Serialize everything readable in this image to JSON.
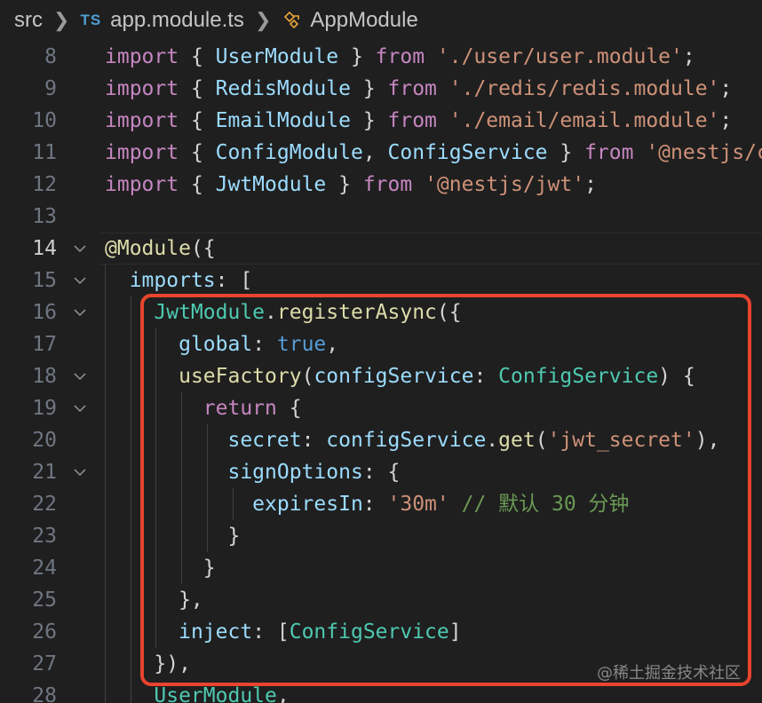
{
  "breadcrumb": {
    "folder": "src",
    "file_lang": "TS",
    "file": "app.module.ts",
    "symbol": "AppModule"
  },
  "colors": {
    "keyword": "#c586c0",
    "variable": "#9cdcfe",
    "string": "#ce9178",
    "type": "#4ec9b0",
    "function": "#dcdcaa",
    "comment": "#6a9955",
    "highlight_box": "#e8442e"
  },
  "lines": [
    {
      "num": "8",
      "fold": false,
      "tokens": [
        [
          "kw",
          "import"
        ],
        [
          "punc",
          " { "
        ],
        [
          "var",
          "UserModule"
        ],
        [
          "punc",
          " } "
        ],
        [
          "kw",
          "from"
        ],
        [
          "punc",
          " "
        ],
        [
          "str",
          "'./user/user.module'"
        ],
        [
          "punc",
          ";"
        ]
      ]
    },
    {
      "num": "9",
      "fold": false,
      "tokens": [
        [
          "kw",
          "import"
        ],
        [
          "punc",
          " { "
        ],
        [
          "var",
          "RedisModule"
        ],
        [
          "punc",
          " } "
        ],
        [
          "kw",
          "from"
        ],
        [
          "punc",
          " "
        ],
        [
          "str",
          "'./redis/redis.module'"
        ],
        [
          "punc",
          ";"
        ]
      ]
    },
    {
      "num": "10",
      "fold": false,
      "tokens": [
        [
          "kw",
          "import"
        ],
        [
          "punc",
          " { "
        ],
        [
          "var",
          "EmailModule"
        ],
        [
          "punc",
          " } "
        ],
        [
          "kw",
          "from"
        ],
        [
          "punc",
          " "
        ],
        [
          "str",
          "'./email/email.module'"
        ],
        [
          "punc",
          ";"
        ]
      ]
    },
    {
      "num": "11",
      "fold": false,
      "tokens": [
        [
          "kw",
          "import"
        ],
        [
          "punc",
          " { "
        ],
        [
          "var",
          "ConfigModule"
        ],
        [
          "punc",
          ", "
        ],
        [
          "var",
          "ConfigService"
        ],
        [
          "punc",
          " } "
        ],
        [
          "kw",
          "from"
        ],
        [
          "punc",
          " "
        ],
        [
          "str",
          "'@nestjs/config'"
        ],
        [
          "punc",
          ";"
        ]
      ]
    },
    {
      "num": "12",
      "fold": false,
      "tokens": [
        [
          "kw",
          "import"
        ],
        [
          "punc",
          " { "
        ],
        [
          "var",
          "JwtModule"
        ],
        [
          "punc",
          " } "
        ],
        [
          "kw",
          "from"
        ],
        [
          "punc",
          " "
        ],
        [
          "str",
          "'@nestjs/jwt'"
        ],
        [
          "punc",
          ";"
        ]
      ]
    },
    {
      "num": "13",
      "fold": false,
      "tokens": []
    },
    {
      "num": "14",
      "fold": true,
      "current": true,
      "tokens": [
        [
          "fn",
          "@Module"
        ],
        [
          "punc",
          "("
        ],
        [
          "punc",
          "{"
        ]
      ]
    },
    {
      "num": "15",
      "fold": true,
      "tokens": [
        [
          "punc",
          "  "
        ],
        [
          "var",
          "imports"
        ],
        [
          "punc",
          ": ["
        ]
      ]
    },
    {
      "num": "16",
      "fold": true,
      "tokens": [
        [
          "punc",
          "    "
        ],
        [
          "type",
          "JwtModule"
        ],
        [
          "punc",
          "."
        ],
        [
          "fn",
          "registerAsync"
        ],
        [
          "punc",
          "({"
        ]
      ]
    },
    {
      "num": "17",
      "fold": false,
      "tokens": [
        [
          "punc",
          "      "
        ],
        [
          "var",
          "global"
        ],
        [
          "punc",
          ": "
        ],
        [
          "bool",
          "true"
        ],
        [
          "punc",
          ","
        ]
      ]
    },
    {
      "num": "18",
      "fold": true,
      "tokens": [
        [
          "punc",
          "      "
        ],
        [
          "fn",
          "useFactory"
        ],
        [
          "punc",
          "("
        ],
        [
          "var",
          "configService"
        ],
        [
          "punc",
          ": "
        ],
        [
          "type",
          "ConfigService"
        ],
        [
          "punc",
          ") {"
        ]
      ]
    },
    {
      "num": "19",
      "fold": true,
      "tokens": [
        [
          "punc",
          "        "
        ],
        [
          "kw",
          "return"
        ],
        [
          "punc",
          " {"
        ]
      ]
    },
    {
      "num": "20",
      "fold": false,
      "tokens": [
        [
          "punc",
          "          "
        ],
        [
          "var",
          "secret"
        ],
        [
          "punc",
          ": "
        ],
        [
          "var",
          "configService"
        ],
        [
          "punc",
          "."
        ],
        [
          "fn",
          "get"
        ],
        [
          "punc",
          "("
        ],
        [
          "str",
          "'jwt_secret'"
        ],
        [
          "punc",
          "),"
        ]
      ]
    },
    {
      "num": "21",
      "fold": true,
      "tokens": [
        [
          "punc",
          "          "
        ],
        [
          "var",
          "signOptions"
        ],
        [
          "punc",
          ": {"
        ]
      ]
    },
    {
      "num": "22",
      "fold": false,
      "tokens": [
        [
          "punc",
          "            "
        ],
        [
          "var",
          "expiresIn"
        ],
        [
          "punc",
          ": "
        ],
        [
          "str",
          "'30m'"
        ],
        [
          "punc",
          " "
        ],
        [
          "cmt",
          "// 默认 30 分钟"
        ]
      ]
    },
    {
      "num": "23",
      "fold": false,
      "tokens": [
        [
          "punc",
          "          }"
        ]
      ]
    },
    {
      "num": "24",
      "fold": false,
      "tokens": [
        [
          "punc",
          "        }"
        ]
      ]
    },
    {
      "num": "25",
      "fold": false,
      "tokens": [
        [
          "punc",
          "      },"
        ]
      ]
    },
    {
      "num": "26",
      "fold": false,
      "tokens": [
        [
          "punc",
          "      "
        ],
        [
          "var",
          "inject"
        ],
        [
          "punc",
          ": ["
        ],
        [
          "type",
          "ConfigService"
        ],
        [
          "punc",
          "]"
        ]
      ]
    },
    {
      "num": "27",
      "fold": false,
      "tokens": [
        [
          "punc",
          "    }),"
        ]
      ]
    },
    {
      "num": "28",
      "fold": false,
      "tokens": [
        [
          "punc",
          "    "
        ],
        [
          "type",
          "UserModule"
        ],
        [
          "punc",
          ","
        ]
      ]
    }
  ],
  "watermark": "@稀土掘金技术社区"
}
